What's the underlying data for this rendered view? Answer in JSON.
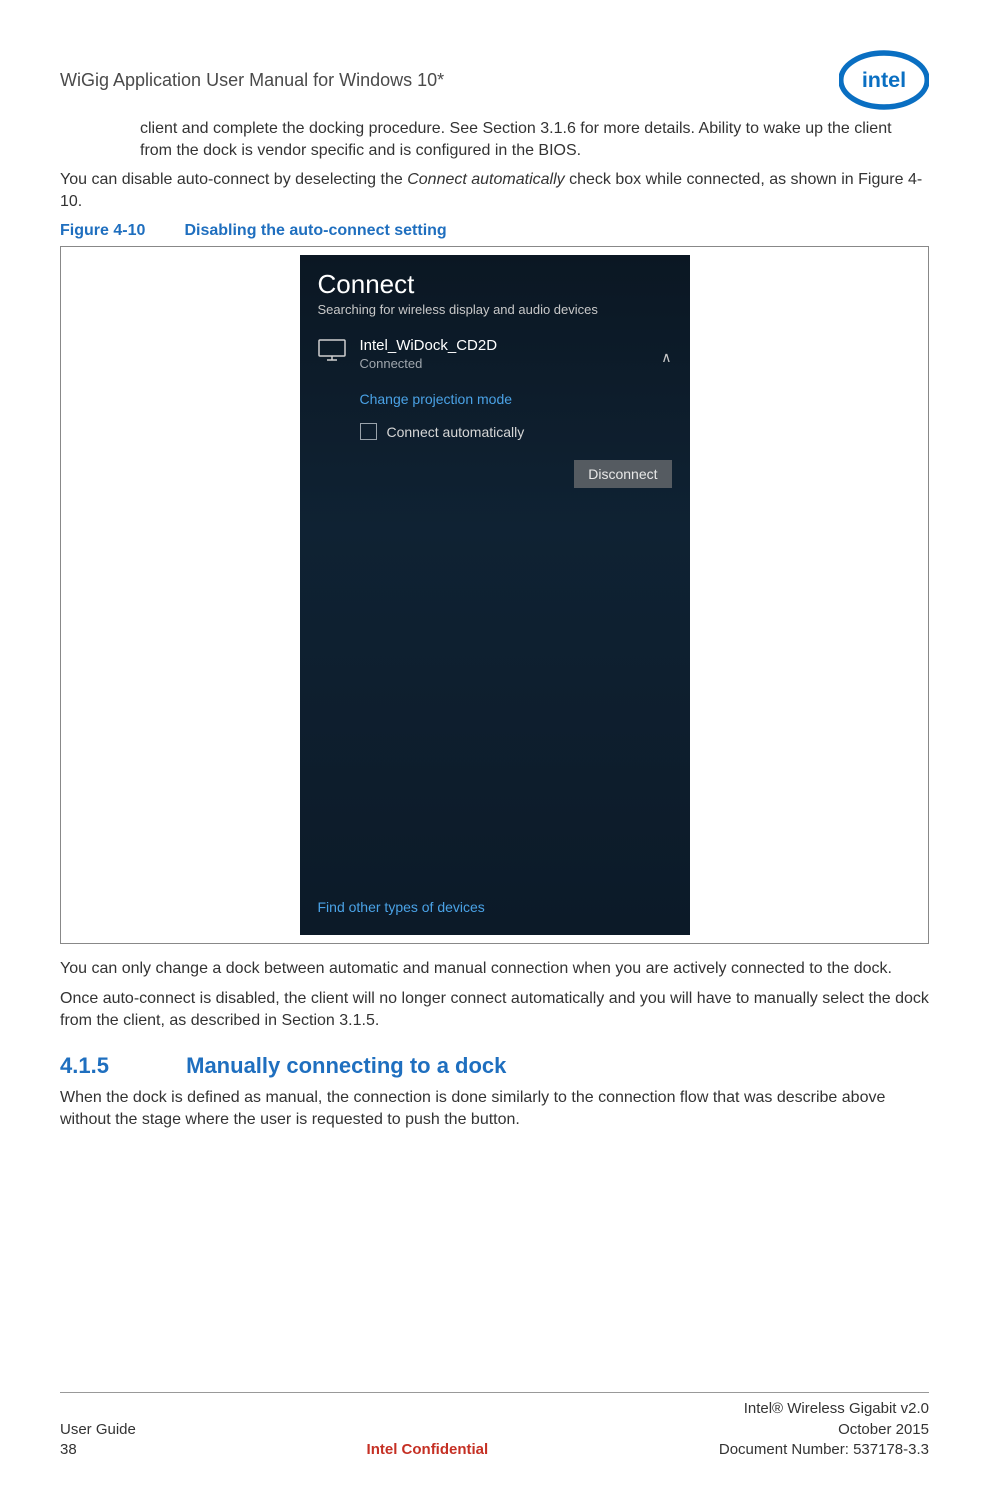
{
  "header": {
    "title": "WiGig Application User Manual for Windows 10*",
    "logo_alt": "intel"
  },
  "content": {
    "para_indent_1": "client and complete the docking procedure. See Section 3.1.6 for more details. Ability to wake up the client from the dock is vendor specific and is configured in the BIOS.",
    "para_2_a": "You can disable auto-connect by deselecting the ",
    "para_2_italic": "Connect automatically",
    "para_2_b": " check box while connected, as shown in Figure 4-10.",
    "figure": {
      "num": "Figure 4-10",
      "title": "Disabling the auto-connect setting"
    },
    "para_3": "You can only change a dock between automatic and manual connection when you are actively connected to the dock.",
    "para_4": "Once auto-connect is disabled, the client will no longer connect automatically and you will have to manually select the dock from the client, as described in Section 3.1.5.",
    "section": {
      "num": "4.1.5",
      "title": "Manually connecting to a dock"
    },
    "para_5": "When the dock is defined as manual, the connection is done similarly to the connection flow that was describe above without the stage where the user is requested to push the button."
  },
  "connect_panel": {
    "title": "Connect",
    "subtitle": "Searching for wireless display and audio devices",
    "device_name": "Intel_WiDock_CD2D",
    "device_status": "Connected",
    "chevron": "∧",
    "change_projection": "Change projection mode",
    "connect_auto_label": "Connect automatically",
    "disconnect": "Disconnect",
    "find_other": "Find other types of devices"
  },
  "footer": {
    "left_line1": "User Guide",
    "left_line2": "38",
    "center": "Intel Confidential",
    "right_line1": "Intel® Wireless Gigabit v2.0",
    "right_line2": "October 2015",
    "right_line3": "Document Number: 537178-3.3"
  }
}
